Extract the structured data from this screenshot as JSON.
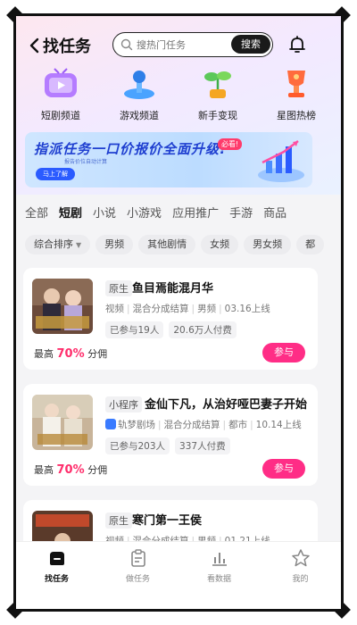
{
  "header": {
    "title": "找任务",
    "search_placeholder": "搜热门任务",
    "search_button": "搜索"
  },
  "quick_links": [
    {
      "label": "短剧频道",
      "icon": "tv-icon"
    },
    {
      "label": "游戏频道",
      "icon": "joystick-icon"
    },
    {
      "label": "新手变现",
      "icon": "sprout-icon"
    },
    {
      "label": "星图热榜",
      "icon": "trophy-icon"
    }
  ],
  "banner": {
    "title": "指派任务一口价报价全面升级!",
    "badge": "必看!",
    "subtitle": "报告价位自动计算",
    "cta": "马上了解"
  },
  "tabs": [
    "全部",
    "短剧",
    "小说",
    "小游戏",
    "应用推广",
    "手游",
    "商品"
  ],
  "active_tab": "短剧",
  "filters": [
    "综合排序",
    "男频",
    "其他剧情",
    "女频",
    "男女频",
    "都"
  ],
  "cards": [
    {
      "tag": "原生",
      "title": "鱼目焉能混月华",
      "meta": [
        "视频",
        "混合分成结算",
        "男频",
        "03.16上线"
      ],
      "stats": [
        "已参与19人",
        "20.6万人付费"
      ],
      "commission_prefix": "最高",
      "commission_pct": "70%",
      "commission_suffix": "分佣",
      "button": "参与"
    },
    {
      "tag": "小程序",
      "title": "金仙下凡，从治好哑巴妻子开始",
      "meta": [
        "轨梦剧场",
        "混合分成结算",
        "都市",
        "10.14上线"
      ],
      "stats": [
        "已参与203人",
        "337人付费"
      ],
      "commission_prefix": "最高",
      "commission_pct": "70%",
      "commission_suffix": "分佣",
      "button": "参与"
    },
    {
      "tag": "原生",
      "title": "寒门第一王侯",
      "meta": [
        "视频",
        "混合分成结算",
        "男频",
        "01.21上线"
      ],
      "stats": [],
      "button": ""
    }
  ],
  "bottom_nav": [
    {
      "label": "找任务",
      "icon": "find-task-icon"
    },
    {
      "label": "做任务",
      "icon": "clipboard-icon"
    },
    {
      "label": "看数据",
      "icon": "bar-chart-icon"
    },
    {
      "label": "我的",
      "icon": "star-face-icon"
    }
  ],
  "colors": {
    "accent": "#ff2d6b",
    "button": "#ff2d86",
    "banner_text": "#1f3fd0"
  }
}
